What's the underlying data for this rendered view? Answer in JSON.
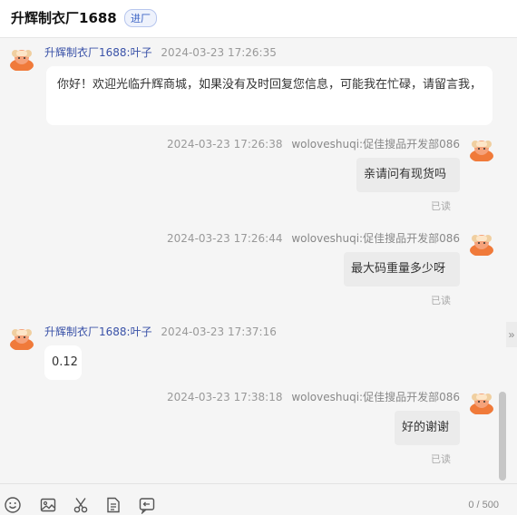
{
  "header": {
    "title": "升辉制衣厂1688",
    "badge": "进厂"
  },
  "messages": [
    {
      "side": "left",
      "name": "升辉制衣厂1688:叶子",
      "time": "2024-03-23 17:26:35",
      "text": "你好！欢迎光临升辉商城，如果没有及时回复您信息，可能我在忙碌，请留言我，",
      "read": ""
    },
    {
      "side": "right",
      "name": "woloveshuqi:促佳搜品开发部086",
      "time": "2024-03-23 17:26:38",
      "text": "亲请问有现货吗",
      "read": "已读"
    },
    {
      "side": "right",
      "name": "woloveshuqi:促佳搜品开发部086",
      "time": "2024-03-23 17:26:44",
      "text": "最大码重量多少呀",
      "read": "已读"
    },
    {
      "side": "left",
      "name": "升辉制衣厂1688:叶子",
      "time": "2024-03-23 17:37:16",
      "text": "0.12",
      "read": ""
    },
    {
      "side": "right",
      "name": "woloveshuqi:促佳搜品开发部086",
      "time": "2024-03-23 17:38:18",
      "text": "好的谢谢",
      "read": "已读"
    }
  ],
  "input": {
    "counter": "0 / 500"
  },
  "toolbar": {
    "icons": [
      "emoji-icon",
      "image-icon",
      "scissors-icon",
      "document-icon",
      "chat-history-icon"
    ]
  },
  "expand_label": "»"
}
